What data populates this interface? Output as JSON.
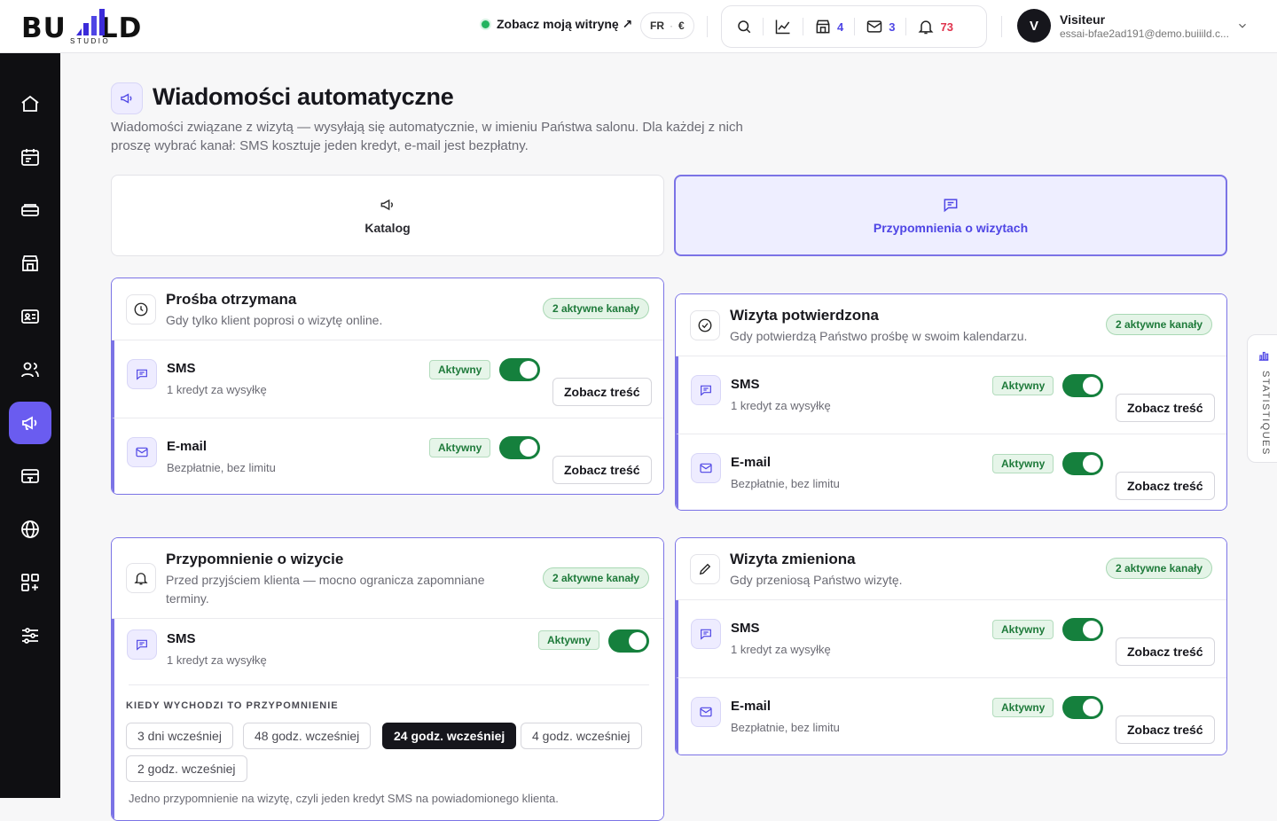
{
  "brand": {
    "logo_text": "BUILD",
    "logo_sub": "STUDIO"
  },
  "topbar": {
    "site_link": "Zobacz moją witrynę ↗",
    "lang": "FR",
    "currency": "€",
    "counts": {
      "shop": "4",
      "mail": "3",
      "notifications": "73"
    }
  },
  "user": {
    "name": "Visiteur",
    "email": "essai-bfae2ad191@demo.buiiild.c...",
    "initial": "V"
  },
  "sidebar": {
    "items": [
      "home",
      "calendar",
      "services",
      "shop",
      "clients-card",
      "team",
      "marketing",
      "billing",
      "website",
      "apps",
      "settings"
    ],
    "active": "marketing"
  },
  "page": {
    "title": "Wiadomości automatyczne",
    "description": "Wiadomości związane z wizytą — wysyłają się automatycznie, w imieniu Państwa salonu. Dla każdej z nich proszę wybrać kanał: SMS kosztuje jeden kredyt, e-mail jest bezpłatny."
  },
  "tabs": [
    {
      "label": "Katalog",
      "icon": "megaphone-icon",
      "selected": false
    },
    {
      "label": "Przypomnienia o wizytach",
      "icon": "message-icon",
      "selected": true
    }
  ],
  "common": {
    "active": "Aktywny",
    "view_content": "Zobacz treść",
    "sms": "SMS",
    "sms_sub": "1 kredyt za wysyłkę",
    "email": "E-mail",
    "email_sub": "Bezpłatnie, bez limitu",
    "channels_badge": "2 aktywne kanały"
  },
  "cards": {
    "request": {
      "title": "Prośba otrzymana",
      "subtitle": "Gdy tylko klient poprosi o wizytę online."
    },
    "confirmed": {
      "title": "Wizyta potwierdzona",
      "subtitle": "Gdy potwierdzą Państwo prośbę w swoim kalendarzu."
    },
    "reminder": {
      "title": "Przypomnienie o wizycie",
      "subtitle": "Przed przyjściem klienta — mocno ogranicza zapomniane terminy.",
      "when_label": "KIEDY WYCHODZI TO PRZYPOMNIENIE",
      "options": [
        "3 dni wcześniej",
        "48 godz. wcześniej",
        "24 godz. wcześniej",
        "4 godz. wcześniej",
        "2 godz. wcześniej"
      ],
      "selected_option": "24 godz. wcześniej",
      "note": "Jedno przypomnienie na wizytę, czyli jeden kredyt SMS na powiadomionego klienta."
    },
    "changed": {
      "title": "Wizyta zmieniona",
      "subtitle": "Gdy przeniosą Państwo wizytę."
    }
  },
  "stats_tab": {
    "label": "STATISTIQUES"
  },
  "colors": {
    "accent": "#6a5cf0",
    "success": "#15803d",
    "sidebar": "#0f0f12"
  }
}
